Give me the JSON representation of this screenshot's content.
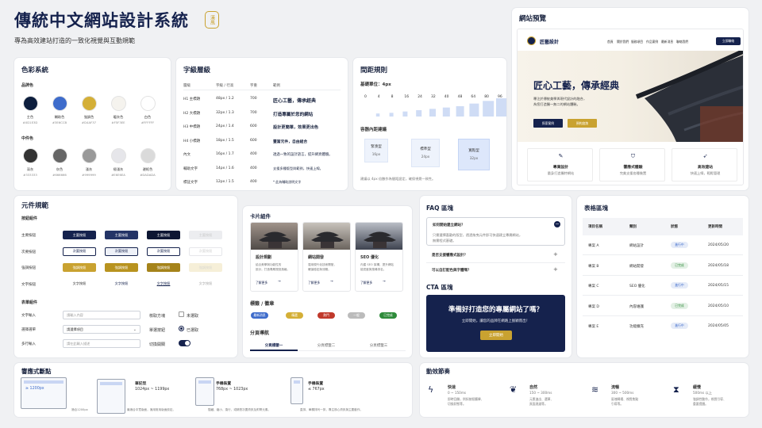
{
  "header": {
    "title": "傳統中文網站設計系統",
    "seal": "漢風",
    "subtitle": "專為高效建站打造的一致化視覺與互動規範"
  },
  "colors": {
    "title": "色彩系統",
    "brand_label": "品牌色",
    "neutral_label": "中件色",
    "brand": [
      {
        "name": "主色",
        "hex": "#0D1E3D"
      },
      {
        "name": "輔助色",
        "hex": "#3E6CCB"
      },
      {
        "name": "強調色",
        "hex": "#D4AF37"
      },
      {
        "name": "暖灰色",
        "hex": "#F5F3EE"
      },
      {
        "name": "白色",
        "hex": "#FFFFFF"
      }
    ],
    "neutral": [
      {
        "name": "深灰",
        "hex": "#333333"
      },
      {
        "name": "灰色",
        "hex": "#666666"
      },
      {
        "name": "淺灰",
        "hex": "#999999"
      },
      {
        "name": "極淺灰",
        "hex": "#E6E6EA"
      },
      {
        "name": "邊框色",
        "hex": "#DADADA"
      }
    ]
  },
  "typo": {
    "title": "字級層級",
    "headers": [
      "層級",
      "字級 / 行高",
      "字重",
      "範例"
    ],
    "rows": [
      [
        "H1 主標題",
        "48px / 1.2",
        "700",
        "匠心工藝，傳承經典"
      ],
      [
        "H2 大標題",
        "32px / 1.3",
        "700",
        "打造專屬於您的網站"
      ],
      [
        "H3 中標題",
        "24px / 1.4",
        "600",
        "設計更簡單，效果更出色"
      ],
      [
        "H4 小標題",
        "18px / 1.5",
        "600",
        "豐富元件，自由組合"
      ],
      [
        "內文",
        "16px / 1.7",
        "400",
        "透過一致的設計語言，提升網頁體驗。"
      ],
      [
        "輔助文字",
        "14px / 1.6",
        "400",
        "支援多種版型與範例，快速上線。"
      ],
      [
        "標註文字",
        "12px / 1.5",
        "400",
        "* 此為輔助說明文字"
      ]
    ]
  },
  "spacing": {
    "title": "間距規則",
    "base": "基礎單位：4px",
    "values": [
      "0",
      "4",
      "8",
      "16",
      "24",
      "32",
      "40",
      "48",
      "64",
      "80",
      "96"
    ],
    "container_title": "容器內距建議",
    "containers": [
      {
        "label": "緊湊型",
        "value": "16px"
      },
      {
        "label": "標準型",
        "value": "24px"
      },
      {
        "label": "寬鬆型",
        "value": "32px"
      }
    ],
    "note": "建議以 4px 倍數作為間距設定，確保視覺一致性。"
  },
  "preview": {
    "title": "網站預覽",
    "brand": "匠藝設計",
    "nav": [
      "首頁",
      "關於我們",
      "服務項目",
      "作品案例",
      "最新消息",
      "聯絡我們"
    ],
    "cta": "立即聯絡",
    "hero_title": "匠心工藝，傳承經典",
    "hero_text1": "專注於傳統美學與現代設計的融合，",
    "hero_text2": "為您打造獨一無二的網站體驗。",
    "hero_btn1": "探索案例",
    "hero_btn2": "預約諮詢",
    "features": [
      {
        "icon": "design-icon",
        "title": "專業設計",
        "desc": "量身打造獨特網站"
      },
      {
        "icon": "shield-icon",
        "title": "響應式體驗",
        "desc": "完美支援各種裝置"
      },
      {
        "icon": "rocket-icon",
        "title": "高效建站",
        "desc": "快速上線，輕鬆管理"
      }
    ]
  },
  "components": {
    "title": "元件規範",
    "button_group": "按鈕組件",
    "button_rows": [
      {
        "label": "主要按鈕",
        "btn": "主要按鈕"
      },
      {
        "label": "次要按鈕",
        "btn": "次要按鈕"
      },
      {
        "label": "強調按鈕",
        "btn": "強調按鈕"
      },
      {
        "label": "文字按鈕",
        "btn": "文字按鈕"
      }
    ],
    "form_group": "表單組件",
    "forms": [
      {
        "label": "文字輸入",
        "placeholder": "請輸入內容"
      },
      {
        "label": "選擇選單",
        "value": "請選擇項目"
      },
      {
        "label": "多行輸入",
        "placeholder": "請在此輸入描述"
      }
    ],
    "checkbox": {
      "label": "核取方塊",
      "option": "未選取"
    },
    "radio": {
      "label": "單選按鈕",
      "option": "已選取"
    },
    "toggle": {
      "label": "切換開關"
    }
  },
  "cards": {
    "title": "卡片組件",
    "items": [
      {
        "title": "設計規劃",
        "desc1": "結合美學與功能性的",
        "desc2": "設計，打造專屬視覺風格。",
        "link": "了解更多"
      },
      {
        "title": "網站開發",
        "desc1": "運用現代化技術開發，",
        "desc2": "確保穩定與流暢。",
        "link": "了解更多"
      },
      {
        "title": "SEO 優化",
        "desc1": "內建 SEO 架構，提升網站",
        "desc2": "能見度與搜尋排名。",
        "link": "了解更多"
      }
    ],
    "tags_title": "標籤 / 徽章",
    "tags": [
      {
        "text": "最新消息",
        "color": "#3E6CCB"
      },
      {
        "text": "精選",
        "color": "#D4AF37"
      },
      {
        "text": "熱門",
        "color": "#C0392B"
      },
      {
        "text": "一般",
        "color": "#BBBBBB"
      },
      {
        "text": "已完成",
        "color": "#2E8B3A"
      }
    ],
    "tabs_title": "分頁導航",
    "tabs": [
      "分頁標籤一",
      "分頁標籤二",
      "分頁標籤三"
    ]
  },
  "faq": {
    "title": "FAQ 區塊",
    "items": [
      {
        "q": "如何開始建立網站？",
        "a1": "只需選擇喜歡的版型，透過拖曳元件即可快速建立專屬網站，",
        "a2": "無需程式基礎。"
      },
      {
        "q": "是否支援響應式設計？"
      },
      {
        "q": "可以自訂配色與字體嗎？"
      }
    ]
  },
  "cta": {
    "title": "CTA 區塊",
    "heading": "準備好打造您的專屬網站了嗎？",
    "text": "立即開始，讓您的品牌在網路上脫穎而出！",
    "btn": "立即開始"
  },
  "table": {
    "title": "表格區塊",
    "headers": [
      "項目名稱",
      "類別",
      "狀態",
      "更新時間"
    ],
    "rows": [
      [
        "專案 A",
        "網站設計",
        "進行中",
        "2024/05/20"
      ],
      [
        "專案 B",
        "網站開發",
        "已完成",
        "2024/05/18"
      ],
      [
        "專案 C",
        "SEO 優化",
        "進行中",
        "2024/05/15"
      ],
      [
        "專案 D",
        "內容維護",
        "已完成",
        "2024/05/10"
      ],
      [
        "專案 E",
        "功能擴充",
        "進行中",
        "2024/05/05"
      ]
    ],
    "status_colors": {
      "進行中": "#3E6CCB",
      "已完成": "#2E8B3A"
    }
  },
  "responsive": {
    "title": "響應式斷點",
    "items": [
      {
        "name": "",
        "range": "≥ 1200px",
        "note": "適合1200px"
      },
      {
        "name": "筆記型",
        "range": "1024px ~ 1199px",
        "note": "最適合中寬版面，適用常用版面設定。"
      },
      {
        "name": "手機裝置",
        "range": "768px ~ 1023px",
        "note": "隱藏、縮小、換行、或精簡次要資訊及附帶元素。"
      },
      {
        "name": "手機裝置",
        "range": "≤ 767px",
        "note": "直排、單欄排列一排，專注核心資訊與主要動作。"
      }
    ]
  },
  "motion": {
    "title": "動效節奏",
    "items": [
      {
        "name": "快速",
        "range": "0 ~ 150ms",
        "d1": "即時回饋，例如按鈕觸擊、",
        "d2": "切換狀態等。",
        "icon": "bolt-icon"
      },
      {
        "name": "自然",
        "range": "150 ~ 300ms",
        "d1": "元素進出、選單、",
        "d2": "頁面過渡等。",
        "icon": "leaf-icon"
      },
      {
        "name": "流暢",
        "range": "300 ~ 500ms",
        "d1": "區塊轉場、視覺焦點",
        "d2": "引導等。",
        "icon": "wave-icon"
      },
      {
        "name": "緩慢",
        "range": "500ms 以上",
        "d1": "強調性動作，視覺引導、",
        "d2": "重要提醒。",
        "icon": "hourglass-icon"
      }
    ]
  }
}
